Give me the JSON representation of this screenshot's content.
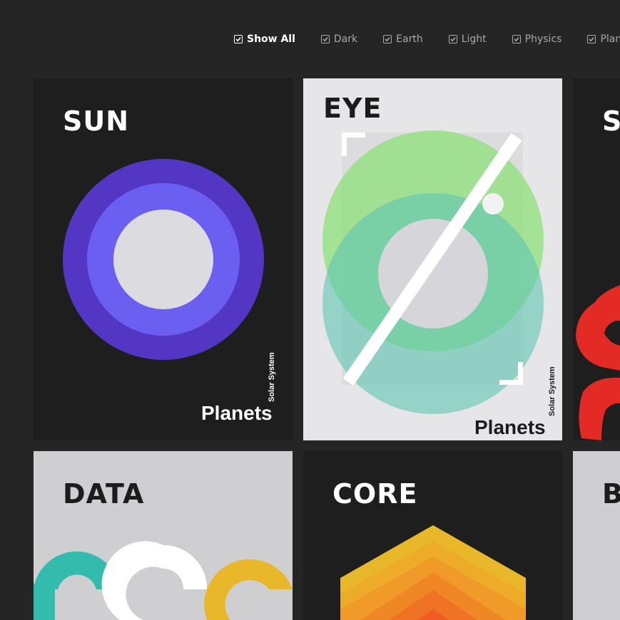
{
  "filters": [
    {
      "label": "Show All",
      "active": true
    },
    {
      "label": "Dark",
      "active": false
    },
    {
      "label": "Earth",
      "active": false
    },
    {
      "label": "Light",
      "active": false
    },
    {
      "label": "Physics",
      "active": false
    },
    {
      "label": "Planets",
      "active": false
    }
  ],
  "cards": {
    "sun": {
      "title": "SUN",
      "subtitle": "Solar System",
      "footer": "Planets"
    },
    "eye": {
      "title": "EYE",
      "subtitle": "Solar System",
      "footer": "Planets"
    },
    "third": {
      "title": "S"
    },
    "data": {
      "title": "DATA"
    },
    "core": {
      "title": "CORE"
    },
    "sixth": {
      "title": "B"
    }
  },
  "colors": {
    "background": "#252526",
    "dark_card": "#1e1e1f",
    "light_card": "#e6e6e8",
    "grey_card": "#cfcfd1",
    "purple_outer": "#5436c5",
    "purple_inner": "#6b5ff2",
    "center": "#dcdce0",
    "red": "#e42a25",
    "teal": "#33bcae",
    "yellow": "#e9b82a"
  }
}
